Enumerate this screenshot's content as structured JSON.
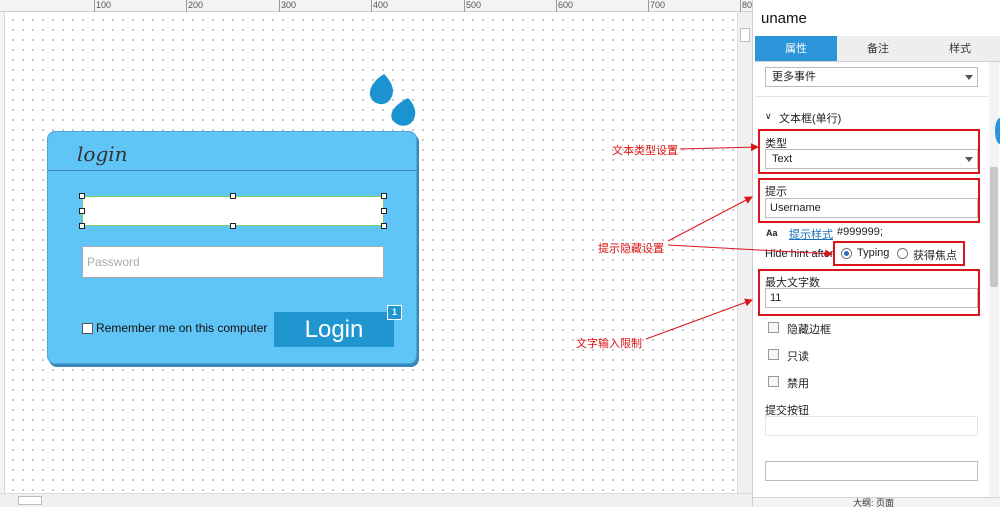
{
  "ruler": {
    "ticks": [
      "100",
      "200",
      "300",
      "400",
      "500",
      "600",
      "700",
      "80"
    ]
  },
  "login_widget": {
    "title": "login",
    "password_placeholder": "Password",
    "remember_label": "Remember me on this computer",
    "button_label": "Login",
    "badge": "1"
  },
  "annotations": {
    "text_type": "文本类型设置",
    "hint_hide": "提示隐藏设置",
    "max_length": "文字输入限制"
  },
  "panel": {
    "title": "uname",
    "tabs": [
      {
        "label": "属性",
        "active": true
      },
      {
        "label": "备注",
        "active": false
      },
      {
        "label": "样式",
        "active": false
      }
    ],
    "more_events": "更多事件",
    "section_header": "文本框(单行)",
    "type_label": "类型",
    "type_value": "Text",
    "hint_label": "提示",
    "hint_value": "Username",
    "hint_style_icon": "Aa",
    "hint_style_link": "提示样式",
    "hint_style_color": "#999999;",
    "hide_hint_label": "Hide hint after",
    "hide_hint_options": [
      {
        "label": "Typing",
        "selected": true
      },
      {
        "label": "获得焦点",
        "selected": false
      }
    ],
    "max_length_label": "最大文字数",
    "max_length_value": "11",
    "checkboxes": [
      {
        "label": "隐藏边框",
        "checked": false
      },
      {
        "label": "只读",
        "checked": false
      },
      {
        "label": "禁用",
        "checked": false
      }
    ],
    "submit_button_label": "提交按钮",
    "bottom_text": "大纲: 页面"
  },
  "colors": {
    "accent": "#2b95d9",
    "login_bg": "#5fc4f6",
    "login_button": "#1f96d0",
    "annotation": "#d9141b"
  }
}
